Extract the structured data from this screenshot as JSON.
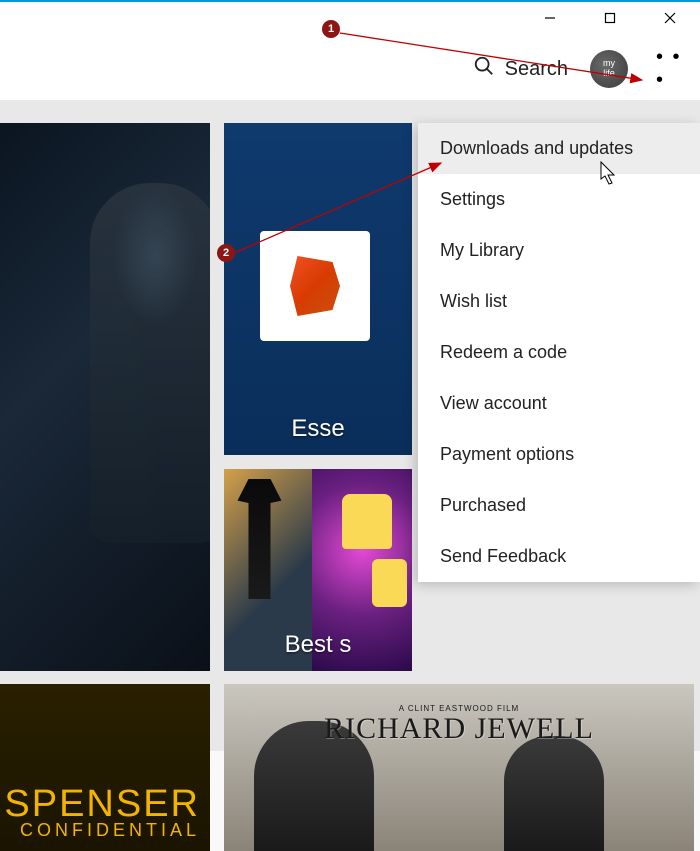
{
  "window_controls": {
    "minimize_name": "minimize-icon",
    "maximize_name": "maximize-icon",
    "close_name": "close-icon"
  },
  "toolbar": {
    "search_label": "Search",
    "avatar_line1": "my",
    "avatar_line2": "life",
    "more_glyph": "• • •"
  },
  "tiles": {
    "essential_label": "Esse",
    "bestsellers_label": "Best s",
    "spenser_title": "SPENSER",
    "spenser_sub": "CONFIDENTIAL",
    "richard_tagline": "A CLINT EASTWOOD FILM",
    "richard_title": "RICHARD JEWELL"
  },
  "menu": {
    "items": [
      {
        "label": "Downloads and updates",
        "hover": true
      },
      {
        "label": "Settings"
      },
      {
        "label": "My Library"
      },
      {
        "label": "Wish list"
      },
      {
        "label": "Redeem a code"
      },
      {
        "label": "View account"
      },
      {
        "label": "Payment options"
      },
      {
        "label": "Purchased"
      },
      {
        "label": "Send Feedback"
      }
    ]
  },
  "annotations": {
    "one": "1",
    "two": "2"
  }
}
